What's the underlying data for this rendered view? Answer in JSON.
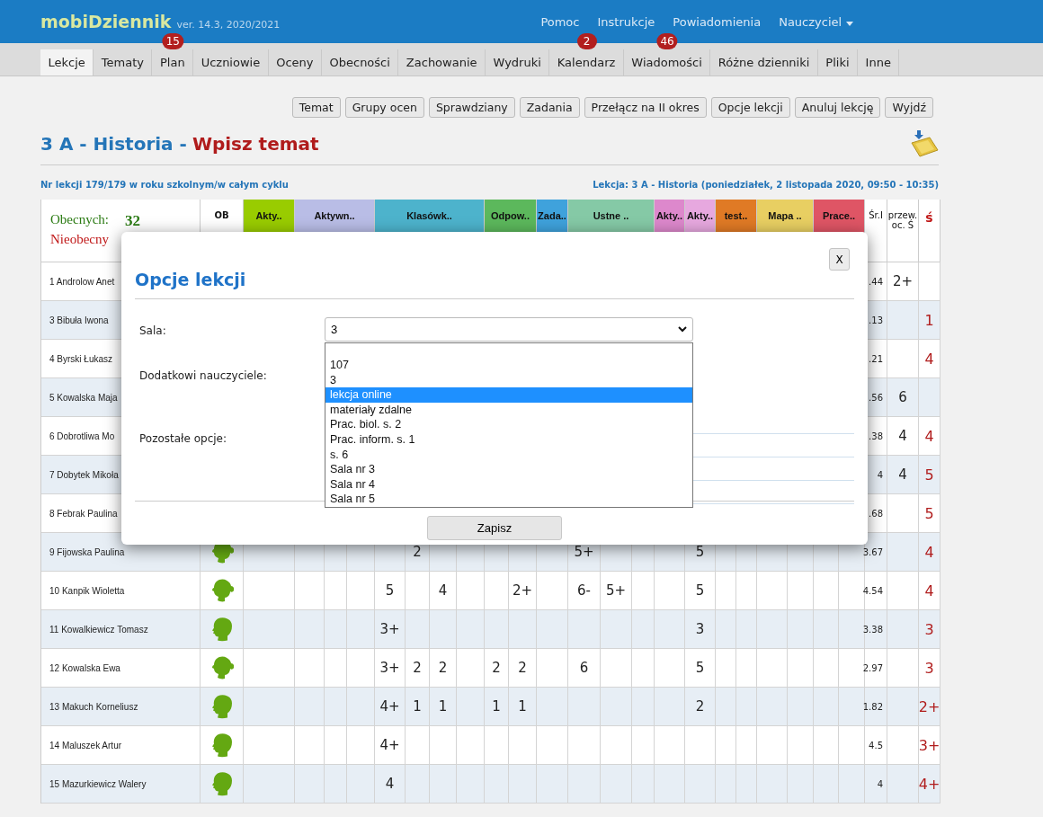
{
  "header": {
    "logo": "mobiDziennik",
    "version": "ver. 14.3, 2020/2021",
    "menu": [
      "Pomoc",
      "Instrukcje",
      "Powiadomienia"
    ],
    "user": "Nauczyciel"
  },
  "nav": [
    {
      "label": "Lekcje",
      "selected": true
    },
    {
      "label": "Tematy",
      "selected": false
    },
    {
      "label": "Plan",
      "selected": false,
      "badge": "15"
    },
    {
      "label": "Uczniowie",
      "selected": false
    },
    {
      "label": "Oceny",
      "selected": false
    },
    {
      "label": "Obecności",
      "selected": false
    },
    {
      "label": "Zachowanie",
      "selected": false
    },
    {
      "label": "Wydruki",
      "selected": false
    },
    {
      "label": "Kalendarz",
      "selected": false,
      "badge": "2"
    },
    {
      "label": "Wiadomości",
      "selected": false,
      "badge": "46"
    },
    {
      "label": "Różne dzienniki",
      "selected": false
    },
    {
      "label": "Pliki",
      "selected": false
    },
    {
      "label": "Inne",
      "selected": false
    }
  ],
  "actions": [
    "Temat",
    "Grupy ocen",
    "Sprawdziany",
    "Zadania",
    "Przełącz na II okres",
    "Opcje lekcji",
    "Anuluj lekcję",
    "Wyjdź"
  ],
  "title": {
    "subject": "3 A - Historia -",
    "action": "Wpisz temat"
  },
  "info_left": "Nr lekcji 179/179 w roku szkolnym/w całym cyklu",
  "info_right": "Lekcja: 3 A - Historia (poniedziałek, 2 listopada 2020, 09:50 - 10:35)",
  "table": {
    "present_label": "Obecnych:",
    "present_count": "32",
    "absent_label": "Nieobecny",
    "ob_header": "OB",
    "categories": [
      {
        "label": "Akty..",
        "color": "#99cc00"
      },
      {
        "label": "Aktywn..",
        "color": "#b9bde6"
      },
      {
        "label": "Klasówk..",
        "color": "#4db3cc"
      },
      {
        "label": "Odpow..",
        "color": "#5cb85c"
      },
      {
        "label": "Zada..",
        "color": "#3fa2dc"
      },
      {
        "label": "Ustne ..",
        "color": "#85c9a6"
      },
      {
        "label": "Akty..",
        "color": "#dd88cc"
      },
      {
        "label": "Akty..",
        "color": "#e7a8df"
      },
      {
        "label": "test..",
        "color": "#e07a25"
      },
      {
        "label": "Mapa ..",
        "color": "#e8cf62"
      },
      {
        "label": "Prace..",
        "color": "#df5565"
      }
    ],
    "summary_headers": [
      "Śr.I",
      "przew. oc. Ś",
      "ś"
    ],
    "rows": [
      {
        "name": "1 Androlow Anet",
        "average": ".44",
        "proposed": "2+"
      },
      {
        "name": "3 Bibuła Iwona",
        "average": ".13",
        "final": "1"
      },
      {
        "name": "4 Byrski Łukasz",
        "average": ".21",
        "final": "4"
      },
      {
        "name": "5 Kowalska Maja",
        "average": ".56",
        "proposed": "6"
      },
      {
        "name": "6 Dobrotliwa Mo",
        "average": ".38",
        "proposed": "4",
        "final": "4"
      },
      {
        "name": "7 Dobytek Mikoła",
        "average": "4",
        "proposed": "4",
        "final": "5"
      },
      {
        "name": "8 Febrak Paulina",
        "average": ".68",
        "final": "5"
      },
      {
        "name": "9 Fijowska Paulina",
        "kind": "girl",
        "grades": {
          "col_6": "2",
          "col_12": "5+",
          "col_16": "5"
        },
        "average": "3.67",
        "final": "4"
      },
      {
        "name": "10 Kanpik Wioletta",
        "kind": "girl",
        "grades": {
          "col_5": "5",
          "col_7": "4",
          "col_10": "2+",
          "col_12": "6-",
          "col_13": "5+",
          "col_16": "5"
        },
        "average": "4.54",
        "final": "4"
      },
      {
        "name": "11 Kowalkiewicz Tomasz",
        "kind": "boy",
        "grades": {
          "col_5": "3+",
          "col_16": "3"
        },
        "average": "3.38",
        "final": "3"
      },
      {
        "name": "12 Kowalska Ewa",
        "kind": "girl",
        "grades": {
          "col_5": "3+",
          "col_6": "2",
          "col_7": "2",
          "col_9": "2",
          "col_10": "2",
          "col_12": "6",
          "col_16": "5"
        },
        "average": "2.97",
        "final": "3"
      },
      {
        "name": "13 Makuch Korneliusz",
        "kind": "boy",
        "grades": {
          "col_5": "4+",
          "col_6": "1",
          "col_7": "1",
          "col_9": "1",
          "col_10": "1",
          "col_16": "2"
        },
        "average": "1.82",
        "final": "2+"
      },
      {
        "name": "14 Maluszek Artur",
        "kind": "boy",
        "grades": {
          "col_5": "4+"
        },
        "average": "4.5",
        "final": "3+"
      },
      {
        "name": "15 Mazurkiewicz Walery",
        "kind": "boy",
        "grades": {
          "col_5": "4"
        },
        "average": "4",
        "final": "4+"
      }
    ]
  },
  "modal": {
    "title": "Opcje lekcji",
    "close": "X",
    "fields": [
      {
        "kind": "select",
        "label": "Sala:",
        "value": "3"
      },
      {
        "kind": "field",
        "label": "Dodatkowi nauczyciele:"
      },
      {
        "kind": "options",
        "label": "Pozostałe opcje:"
      }
    ],
    "options": [
      {
        "label": "107",
        "selected": false
      },
      {
        "label": "3",
        "selected": false
      },
      {
        "label": "lekcja online",
        "selected": true
      },
      {
        "label": "materiały zdalne",
        "selected": false
      },
      {
        "label": "Prac. biol. s. 2",
        "selected": false
      },
      {
        "label": "Prac. inform. s. 1",
        "selected": false
      },
      {
        "label": "s. 6",
        "selected": false
      },
      {
        "label": "Sala nr 3",
        "selected": false
      },
      {
        "label": "Sala nr 4",
        "selected": false
      },
      {
        "label": "Sala nr 5",
        "selected": false
      }
    ],
    "save": "Zapisz"
  }
}
